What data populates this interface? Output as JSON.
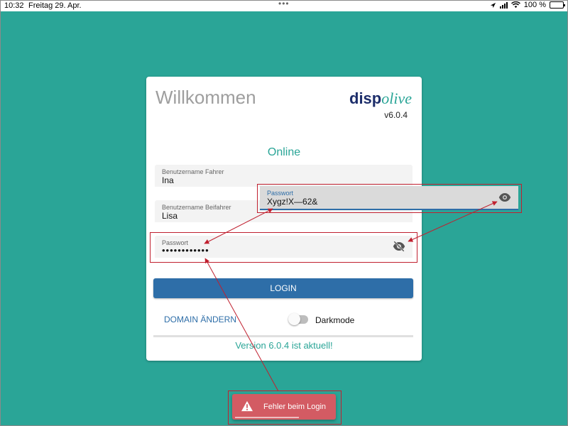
{
  "statusbar": {
    "time": "10:32",
    "date": "Freitag 29. Apr.",
    "battery": "100 %"
  },
  "card": {
    "welcome": "Willkommen",
    "logo_part1": "disp",
    "logo_part2": "olive",
    "version": "v6.0.4",
    "status": "Online",
    "fields": {
      "driver": {
        "label": "Benutzername Fahrer",
        "value": "Ina"
      },
      "codriver": {
        "label": "Benutzername Beifahrer",
        "value": "Lisa"
      },
      "password": {
        "label": "Passwort",
        "value": "••••••••••••"
      }
    },
    "login_label": "LOGIN",
    "domain_label": "DOMAIN ÄNDERN",
    "darkmode_label": "Darkmode",
    "version_status": "Version 6.0.4 ist aktuell!"
  },
  "password_popup": {
    "label": "Passwort",
    "value": "Xygz!X—62&"
  },
  "toast": {
    "text": "Fehler beim Login"
  },
  "colors": {
    "background": "#2aa597",
    "accent": "#2e6ea8",
    "highlight": "#c0202f",
    "error": "#d35b63"
  },
  "icons": [
    "location-icon",
    "signal-icon",
    "wifi-icon",
    "battery-icon",
    "eye-icon",
    "eye-off-icon",
    "warning-icon"
  ]
}
